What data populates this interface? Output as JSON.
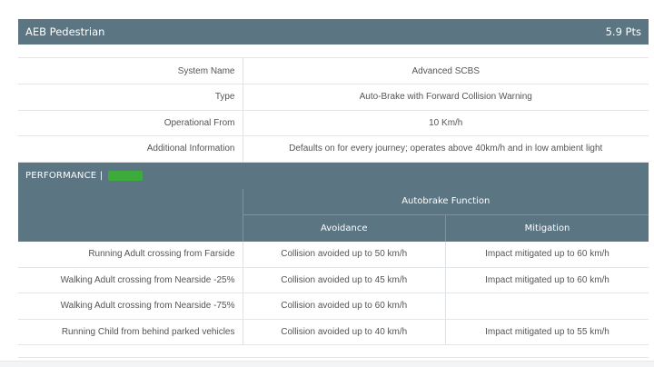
{
  "header": {
    "title": "AEB Pedestrian",
    "score": "5.9 Pts"
  },
  "info_rows": [
    {
      "label": "System Name",
      "value": "Advanced SCBS"
    },
    {
      "label": "Type",
      "value": "Auto-Brake with Forward Collision Warning"
    },
    {
      "label": "Operational From",
      "value": "10 Km/h"
    },
    {
      "label": "Additional Information",
      "value": "Defaults on for every journey; operates above 40km/h and in low ambient light"
    }
  ],
  "performance": {
    "title": "PERFORMANCE |",
    "rating_color": "#3cab3c",
    "function_header": "Autobrake Function",
    "col_avoidance": "Avoidance",
    "col_mitigation": "Mitigation",
    "rows": [
      {
        "scenario": "Running Adult crossing from Farside",
        "avoidance": "Collision avoided up to 50 km/h",
        "mitigation": "Impact mitigated up to 60 km/h"
      },
      {
        "scenario": "Walking Adult crossing from Nearside -25%",
        "avoidance": "Collision avoided up to 45 km/h",
        "mitigation": "Impact mitigated up to 60 km/h"
      },
      {
        "scenario": "Walking Adult crossing from Nearside -75%",
        "avoidance": "Collision avoided up to 60 km/h",
        "mitigation": ""
      },
      {
        "scenario": "Running Child from behind parked vehicles",
        "avoidance": "Collision avoided up to 40 km/h",
        "mitigation": "Impact mitigated up to 55 km/h"
      }
    ]
  },
  "colors": {
    "header_bg": "#5c7583",
    "rating_green": "#3cab3c"
  }
}
